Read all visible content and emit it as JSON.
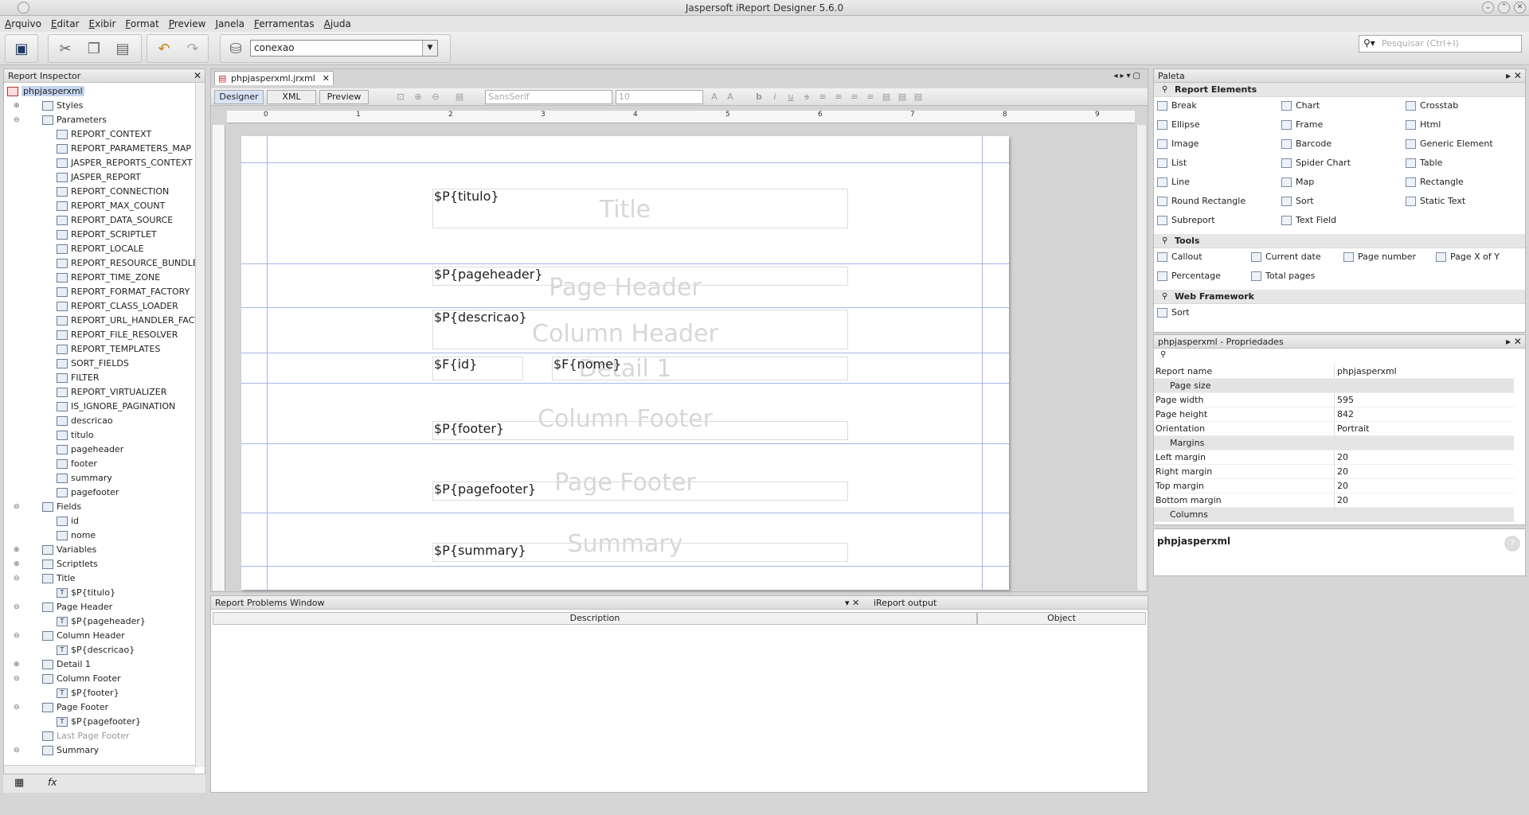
{
  "window": {
    "title": "Jaspersoft iReport Designer 5.6.0"
  },
  "menu": [
    "Arquivo",
    "Editar",
    "Exibir",
    "Format",
    "Preview",
    "Janela",
    "Ferramentas",
    "Ajuda"
  ],
  "toolbar": {
    "connection": "conexao",
    "search_placeholder": "Pesquisar (Ctrl+I)"
  },
  "inspector": {
    "title": "Report Inspector",
    "root": "phpjasperxml",
    "items": [
      {
        "label": "Styles",
        "level": 1,
        "icon": "styles-icon",
        "exp": "+"
      },
      {
        "label": "Parameters",
        "level": 1,
        "icon": "parameters-icon",
        "exp": "-"
      },
      {
        "label": "REPORT_CONTEXT",
        "level": 2,
        "icon": "parameter-icon"
      },
      {
        "label": "REPORT_PARAMETERS_MAP",
        "level": 2,
        "icon": "parameter-icon"
      },
      {
        "label": "JASPER_REPORTS_CONTEXT",
        "level": 2,
        "icon": "parameter-icon"
      },
      {
        "label": "JASPER_REPORT",
        "level": 2,
        "icon": "parameter-icon"
      },
      {
        "label": "REPORT_CONNECTION",
        "level": 2,
        "icon": "parameter-icon"
      },
      {
        "label": "REPORT_MAX_COUNT",
        "level": 2,
        "icon": "parameter-icon"
      },
      {
        "label": "REPORT_DATA_SOURCE",
        "level": 2,
        "icon": "parameter-icon"
      },
      {
        "label": "REPORT_SCRIPTLET",
        "level": 2,
        "icon": "parameter-icon"
      },
      {
        "label": "REPORT_LOCALE",
        "level": 2,
        "icon": "parameter-icon"
      },
      {
        "label": "REPORT_RESOURCE_BUNDLE",
        "level": 2,
        "icon": "parameter-icon"
      },
      {
        "label": "REPORT_TIME_ZONE",
        "level": 2,
        "icon": "parameter-icon"
      },
      {
        "label": "REPORT_FORMAT_FACTORY",
        "level": 2,
        "icon": "parameter-icon"
      },
      {
        "label": "REPORT_CLASS_LOADER",
        "level": 2,
        "icon": "parameter-icon"
      },
      {
        "label": "REPORT_URL_HANDLER_FACTO",
        "level": 2,
        "icon": "parameter-icon"
      },
      {
        "label": "REPORT_FILE_RESOLVER",
        "level": 2,
        "icon": "parameter-icon"
      },
      {
        "label": "REPORT_TEMPLATES",
        "level": 2,
        "icon": "parameter-icon"
      },
      {
        "label": "SORT_FIELDS",
        "level": 2,
        "icon": "parameter-icon"
      },
      {
        "label": "FILTER",
        "level": 2,
        "icon": "parameter-icon"
      },
      {
        "label": "REPORT_VIRTUALIZER",
        "level": 2,
        "icon": "parameter-icon"
      },
      {
        "label": "IS_IGNORE_PAGINATION",
        "level": 2,
        "icon": "parameter-icon"
      },
      {
        "label": "descricao",
        "level": 2,
        "icon": "parameter-icon"
      },
      {
        "label": "titulo",
        "level": 2,
        "icon": "parameter-icon"
      },
      {
        "label": "pageheader",
        "level": 2,
        "icon": "parameter-icon"
      },
      {
        "label": "footer",
        "level": 2,
        "icon": "parameter-icon"
      },
      {
        "label": "summary",
        "level": 2,
        "icon": "parameter-icon"
      },
      {
        "label": "pagefooter",
        "level": 2,
        "icon": "parameter-icon"
      },
      {
        "label": "Fields",
        "level": 1,
        "icon": "fields-icon",
        "exp": "-"
      },
      {
        "label": "id",
        "level": 2,
        "icon": "field-icon"
      },
      {
        "label": "nome",
        "level": 2,
        "icon": "field-icon"
      },
      {
        "label": "Variables",
        "level": 1,
        "icon": "variables-icon",
        "exp": "+"
      },
      {
        "label": "Scriptlets",
        "level": 1,
        "icon": "scriptlets-icon",
        "exp": "+"
      },
      {
        "label": "Title",
        "level": 1,
        "icon": "band-icon",
        "exp": "-"
      },
      {
        "label": "$P{titulo}",
        "level": 2,
        "icon": "textfield-icon"
      },
      {
        "label": "Page Header",
        "level": 1,
        "icon": "band-icon",
        "exp": "-"
      },
      {
        "label": "$P{pageheader}",
        "level": 2,
        "icon": "textfield-icon"
      },
      {
        "label": "Column Header",
        "level": 1,
        "icon": "band-icon",
        "exp": "-"
      },
      {
        "label": "$P{descricao}",
        "level": 2,
        "icon": "textfield-icon"
      },
      {
        "label": "Detail 1",
        "level": 1,
        "icon": "band-icon",
        "exp": "+"
      },
      {
        "label": "Column Footer",
        "level": 1,
        "icon": "band-icon",
        "exp": "-"
      },
      {
        "label": "$P{footer}",
        "level": 2,
        "icon": "textfield-icon"
      },
      {
        "label": "Page Footer",
        "level": 1,
        "icon": "band-icon",
        "exp": "-"
      },
      {
        "label": "$P{pagefooter}",
        "level": 2,
        "icon": "textfield-icon"
      },
      {
        "label": "Last Page Footer",
        "level": 1,
        "icon": "band-icon",
        "dim": true
      },
      {
        "label": "Summary",
        "level": 1,
        "icon": "band-icon",
        "exp": "-"
      }
    ]
  },
  "editor": {
    "tab": "phpjasperxml.jrxml",
    "views": [
      "Designer",
      "XML",
      "Preview"
    ],
    "font_name": "SansSerif",
    "font_size": "10",
    "ruler": [
      "0",
      "1",
      "2",
      "3",
      "4",
      "5",
      "6",
      "7",
      "8",
      "9"
    ],
    "bands": [
      {
        "label": "Title",
        "field": "$P{titulo}"
      },
      {
        "label": "Page Header",
        "field": "$P{pageheader}"
      },
      {
        "label": "Column Header",
        "field": "$P{descricao}"
      },
      {
        "label": "Detail 1",
        "fields": [
          "$F{id}",
          "$F{nome}"
        ]
      },
      {
        "label": "Column Footer",
        "field": "$P{footer}"
      },
      {
        "label": "Page Footer",
        "field": "$P{pagefooter}"
      },
      {
        "label": "Summary",
        "field": "$P{summary}"
      }
    ]
  },
  "problems": {
    "title": "Report Problems Window",
    "output_tab": "iReport output",
    "columns": [
      "Description",
      "Object"
    ]
  },
  "palette": {
    "title": "Paleta",
    "groups": [
      {
        "name": "Report Elements",
        "items": [
          "Break",
          "Chart",
          "Crosstab",
          "Ellipse",
          "Frame",
          "Html",
          "Image",
          "Barcode",
          "Generic Element",
          "List",
          "Spider Chart",
          "Table",
          "Line",
          "Map",
          "Rectangle",
          "Round Rectangle",
          "Sort",
          "Static Text",
          "Subreport",
          "Text Field"
        ]
      },
      {
        "name": "Tools",
        "items": [
          "Callout",
          "Current date",
          "Page number",
          "Page X of Y",
          "Percentage",
          "Total pages"
        ]
      },
      {
        "name": "Web Framework",
        "items": [
          "Sort"
        ]
      }
    ]
  },
  "properties": {
    "title": "phpjasperxml - Propriedades",
    "rows": [
      {
        "k": "Report name",
        "v": "phpjasperxml"
      },
      {
        "k": "Page size",
        "cat": true
      },
      {
        "k": "Page width",
        "v": "595"
      },
      {
        "k": "Page height",
        "v": "842"
      },
      {
        "k": "Orientation",
        "v": "Portrait"
      },
      {
        "k": "Margins",
        "cat": true
      },
      {
        "k": "Left margin",
        "v": "20"
      },
      {
        "k": "Right margin",
        "v": "20"
      },
      {
        "k": "Top margin",
        "v": "20"
      },
      {
        "k": "Bottom margin",
        "v": "20"
      },
      {
        "k": "Columns",
        "cat": true
      }
    ],
    "desc_title": "phpjasperxml"
  }
}
